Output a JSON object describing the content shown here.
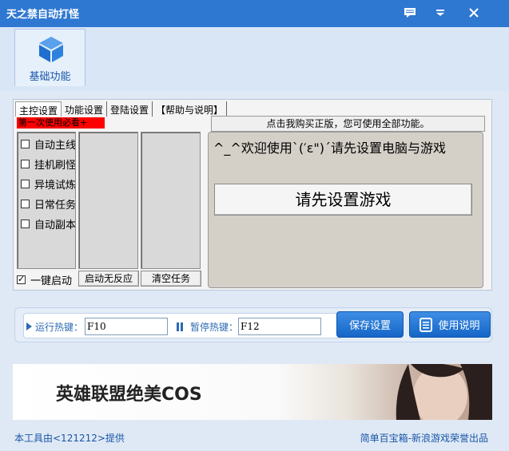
{
  "window": {
    "title": "天之禁自动打怪",
    "icons": [
      "chat-icon",
      "dropdown-icon",
      "close-icon"
    ]
  },
  "toolbar": {
    "basic_function_label": "基础功能"
  },
  "tabs": [
    "主控设置",
    "功能设置",
    "登陆设置",
    "【帮助与说明】"
  ],
  "notice": "第一次使用必看+",
  "buy_bar": "点击我购买正版，您可使用全部功能。",
  "task_list": [
    {
      "label": "自动主线",
      "checked": false
    },
    {
      "label": "挂机刷怪",
      "checked": false
    },
    {
      "label": "异境试炼",
      "checked": false
    },
    {
      "label": "日常任务",
      "checked": false
    },
    {
      "label": "自动副本",
      "checked": false
    }
  ],
  "one_click_start": {
    "label": "一键启动",
    "checked": true
  },
  "buttons": {
    "start_unresponsive": "启动无反应",
    "clear_tasks": "清空任务"
  },
  "welcome": {
    "message": "^_^欢迎使用`(′ε\")´请先设置电脑与游戏",
    "setup_button": "请先设置游戏"
  },
  "hotkeys": {
    "run_label": "运行热键：",
    "run_value": "F10",
    "pause_label": "暂停热键：",
    "pause_value": "F12",
    "save_button": "保存设置",
    "manual_button": "使用说明"
  },
  "banner": {
    "text": "英雄联盟绝美COS"
  },
  "footer": {
    "left": "本工具由<121212>提供",
    "right": "简单百宝箱-新浪游戏荣誉出品"
  },
  "colors": {
    "titlebar": "#2f78d1",
    "accent_blue": "#1466c7",
    "notice_red": "#ff0000"
  }
}
